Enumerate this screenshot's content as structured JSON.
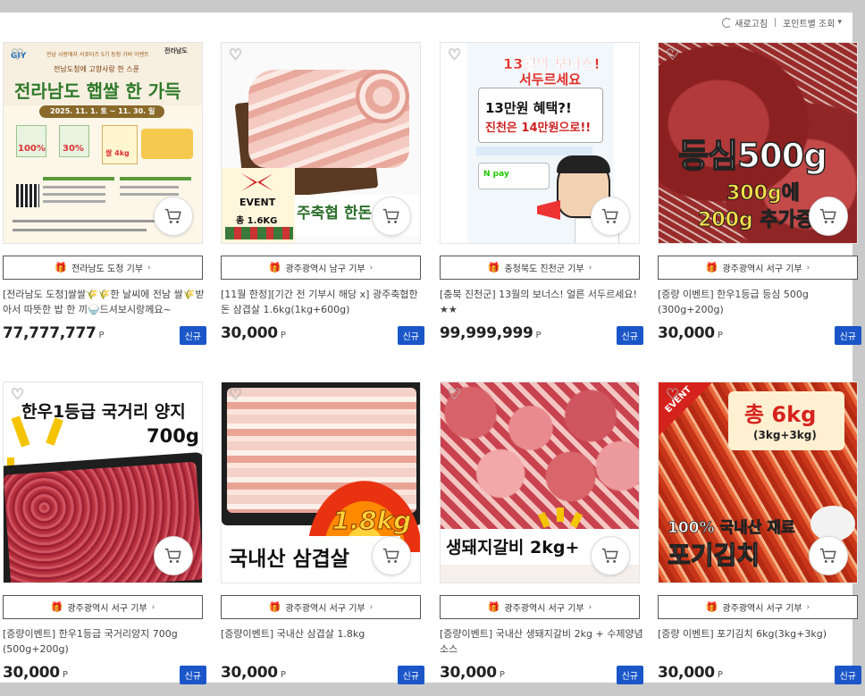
{
  "topbar": {
    "refresh_label": "새로고침",
    "sort_label": "포인트별 조회"
  },
  "currency": "P",
  "badge_label": "신규",
  "products": [
    {
      "donation": "전라남도 도청 기부",
      "title": "[전라남도 도청]쌀쌀🌾🌾한 날씨에 전남 쌀🌾받아서 따뜻한 밥 한 끼🍚드셔보시랑께요~",
      "price": "77,777,777",
      "img": {
        "line1": "전남 사랑애자 서포터즈 5기 등청 가비 이벤트",
        "line2": "전남도청에 고향사랑 한 스푼",
        "headline": "전라남도 햅쌀 한 가득",
        "date": "2025. 11. 1. 토 ~ 11. 30. 일",
        "pct1": "100%",
        "pct2": "30%",
        "rice": "쌀 4kg",
        "logo": "전라남도",
        "logo2": "GIY"
      }
    },
    {
      "donation": "광주광역시 남구 기부",
      "title": "[11월 한정][기간 전 기부시 해당 x] 광주축협한돈 삼겹살 1.6kg(1kg+600g)",
      "price": "30,000",
      "img": {
        "event": "EVENT",
        "total": "총 1.6KG",
        "brand": "주축협 한돈"
      }
    },
    {
      "donation": "충청북도 진천군 기부",
      "title": "[충북 진천군] 13월의 보너스! 얼른 서두르세요! ★★",
      "price": "99,999,999",
      "img": {
        "h1": "13월의 보너스!",
        "h2": "서두르세요",
        "b1": "13만원 혜택?!",
        "b2": "진천은 14만원으로!!",
        "pay": "N pay"
      }
    },
    {
      "donation": "광주광역시 서구 기부",
      "title": "[증량 이벤트] 한우1등급 등심 500g (300g+200g)",
      "price": "30,000",
      "img": {
        "h1": "등심500g",
        "h2": "300g에",
        "h3": "200g 추가증"
      }
    },
    {
      "donation": "광주광역시 서구 기부",
      "title": "[증량이벤트] 한우1등급 국거리양지 700g (500g+200g)",
      "price": "30,000",
      "img": {
        "h1": "한우1등급 국거리 양지",
        "h2": "700g"
      }
    },
    {
      "donation": "광주광역시 서구 기부",
      "title": "[증량이벤트] 국내산 삼겹살 1.8kg",
      "price": "30,000",
      "img": {
        "h1": "1.8kg",
        "h2": "국내산 삼겹살"
      }
    },
    {
      "donation": "광주광역시 서구 기부",
      "title": "[증량이벤트] 국내산 생돼지갈비 2kg + 수제양념소스",
      "price": "30,000",
      "img": {
        "h1": "생돼지갈비 2kg+"
      }
    },
    {
      "donation": "광주광역시 서구 기부",
      "title": "[증량 이벤트] 포기김치 6kg(3kg+3kg)",
      "price": "30,000",
      "img": {
        "event": "EVENT",
        "h1": "총 6kg",
        "h2": "(3kg+3kg)",
        "h3": "100% 국내산 재료",
        "h4": "포기김치"
      }
    }
  ]
}
